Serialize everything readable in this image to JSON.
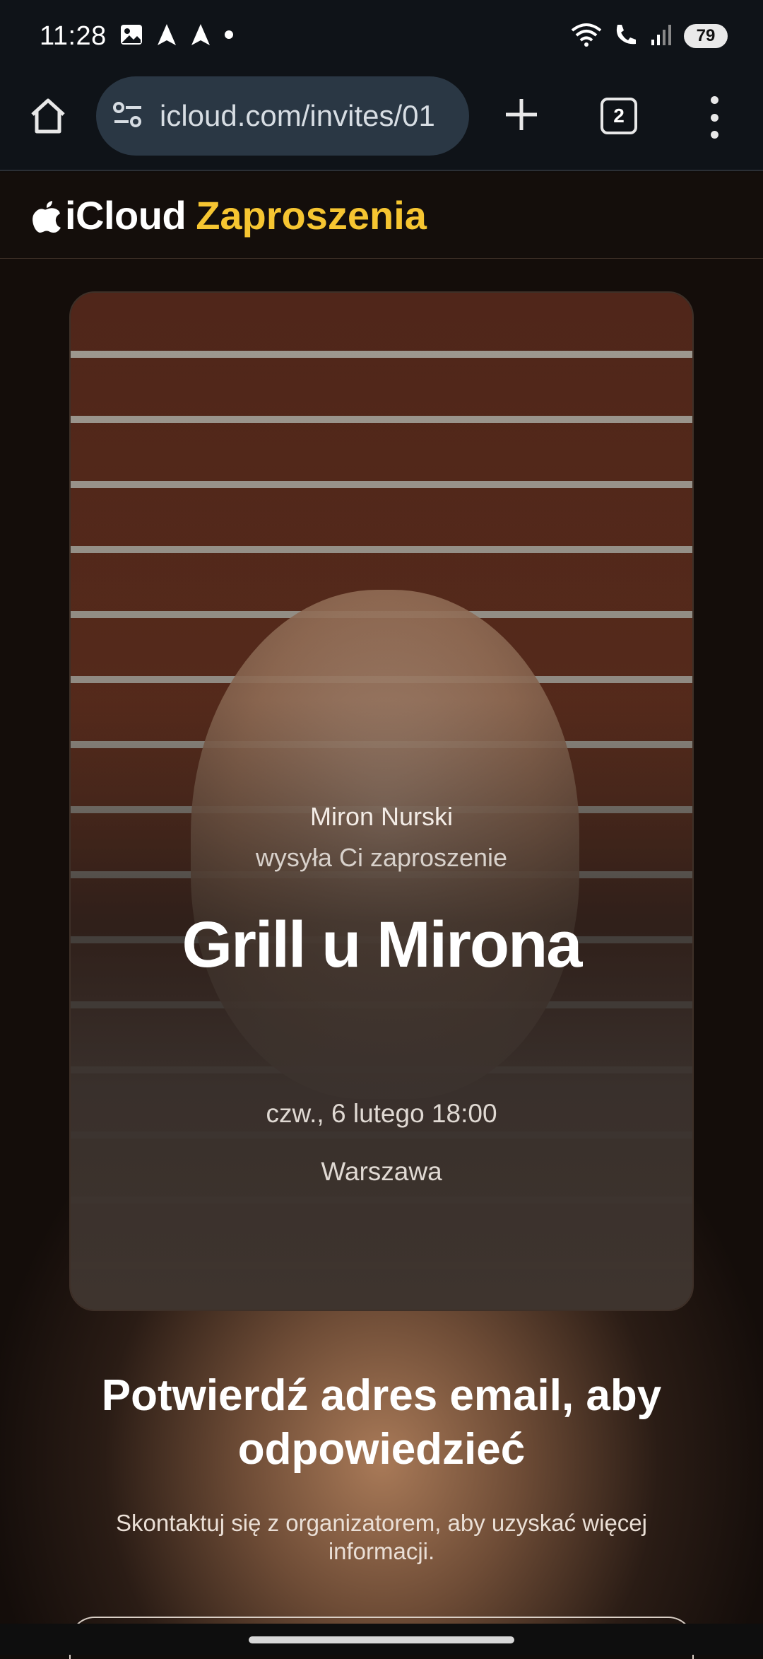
{
  "status_bar": {
    "time": "11:28",
    "battery": "79",
    "icons": [
      "image-icon",
      "navigation-arrow-icon",
      "navigation-arrow-icon",
      "dot-icon",
      "wifi-icon",
      "wifi-calling-icon",
      "signal-icon",
      "battery-icon"
    ]
  },
  "browser": {
    "url": "icloud.com/invites/01",
    "tab_count": "2"
  },
  "site": {
    "brand_name": "iCloud",
    "section": "Zaproszenia"
  },
  "invite": {
    "sender": "Miron Nurski",
    "invite_note": "wysyła Ci zaproszenie",
    "title": "Grill u Mirona",
    "datetime": "czw., 6 lutego 18:00",
    "location": "Warszawa"
  },
  "confirm": {
    "title": "Potwierdź adres email, aby odpowiedzieć",
    "subtitle": "Skontaktuj się z organizatorem, aby uzyskać więcej informacji."
  },
  "colors": {
    "accent": "#f6c531",
    "browser_bg": "#0f1318",
    "url_pill": "#2a3744"
  }
}
